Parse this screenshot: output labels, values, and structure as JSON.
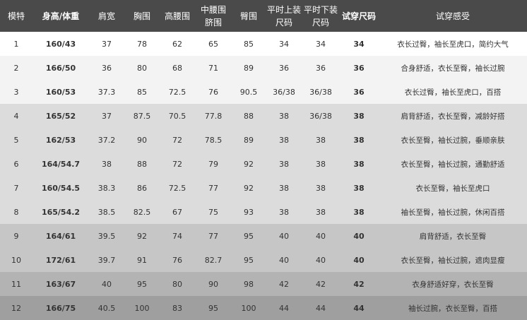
{
  "headers": [
    "模特",
    "身高/体重",
    "肩宽",
    "胸围",
    "高腰围",
    "中腰围\n脐围",
    "臀围",
    "平时上装\n尺码",
    "平时下装\n尺码",
    "试穿尺码",
    "试穿感受"
  ],
  "rows": [
    [
      "1",
      "160/43",
      "37",
      "78",
      "62",
      "65",
      "85",
      "34",
      "34",
      "34",
      "衣长过臀，袖长至虎口，简约大气"
    ],
    [
      "2",
      "166/50",
      "36",
      "80",
      "68",
      "71",
      "89",
      "36",
      "36",
      "36",
      "合身舒适，衣长至臀，袖长过腕"
    ],
    [
      "3",
      "160/53",
      "37.3",
      "85",
      "72.5",
      "76",
      "90.5",
      "36/38",
      "36/38",
      "36",
      "衣长过臀，袖长至虎口，百搭"
    ],
    [
      "4",
      "165/52",
      "37",
      "87.5",
      "70.5",
      "77.8",
      "88",
      "38",
      "36/38",
      "38",
      "肩背舒适，衣长至臀，减龄好搭"
    ],
    [
      "5",
      "162/53",
      "37.2",
      "90",
      "72",
      "78.5",
      "89",
      "38",
      "38",
      "38",
      "衣长至臀，袖长过腕，垂顺亲肤"
    ],
    [
      "6",
      "164/54.7",
      "38",
      "88",
      "72",
      "79",
      "92",
      "38",
      "38",
      "38",
      "衣长至臀，袖长过腕，通勤舒适"
    ],
    [
      "7",
      "160/54.5",
      "38.3",
      "86",
      "72.5",
      "77",
      "92",
      "38",
      "38",
      "38",
      "衣长至臀，袖长至虎口"
    ],
    [
      "8",
      "165/54.2",
      "38.5",
      "82.5",
      "67",
      "75",
      "93",
      "38",
      "38",
      "38",
      "袖长至臀，袖长过腕，休闲百搭"
    ],
    [
      "9",
      "164/61",
      "39.5",
      "92",
      "74",
      "77",
      "95",
      "40",
      "40",
      "40",
      "肩背舒适，衣长至臀"
    ],
    [
      "10",
      "172/61",
      "39.7",
      "91",
      "76",
      "82.7",
      "95",
      "40",
      "40",
      "40",
      "衣长至臀，袖长过腕，遮肉显瘦"
    ],
    [
      "11",
      "163/67",
      "40",
      "95",
      "80",
      "90",
      "98",
      "42",
      "42",
      "42",
      "衣身舒适好穿，衣长至臀"
    ],
    [
      "12",
      "166/75",
      "40.5",
      "100",
      "83",
      "95",
      "100",
      "44",
      "44",
      "44",
      "袖长过腕，衣长至臀，百搭"
    ]
  ],
  "row_groups": [
    "g1",
    "g2",
    "g2",
    "g3",
    "g3",
    "g3",
    "g3",
    "g3",
    "g4",
    "g4",
    "g5",
    "g6"
  ],
  "colors": {
    "header_bg": "#4a4a4a",
    "header_text": "#ffffff",
    "body_text": "#333333"
  }
}
